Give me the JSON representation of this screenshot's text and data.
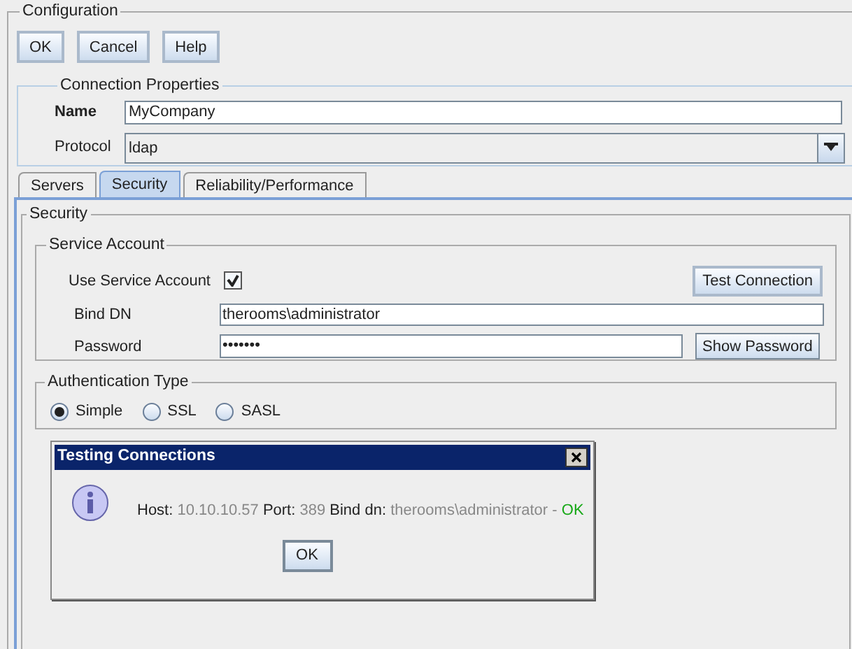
{
  "window": {
    "title": "Configuration"
  },
  "buttons": [
    "OK",
    "Cancel",
    "Help"
  ],
  "connection_properties": {
    "title": "Connection Properties",
    "name": {
      "label": "Name",
      "value": "MyCompany"
    },
    "protocol": {
      "label": "Protocol",
      "value": "ldap"
    }
  },
  "tabs": [
    {
      "label": "Servers",
      "selected": false
    },
    {
      "label": "Security",
      "selected": true
    },
    {
      "label": "Reliability/Performance",
      "selected": false
    }
  ],
  "security": {
    "title": "Security",
    "service_account": {
      "title": "Service Account",
      "use_service_account": {
        "label": "Use Service Account",
        "checked": true
      },
      "test_connection": "Test Connection",
      "bind_dn": {
        "label": "Bind DN",
        "value": "therooms\\administrator"
      },
      "password": {
        "label": "Password",
        "value": "•••••••"
      },
      "show_password": "Show Password"
    },
    "authentication_type": {
      "title": "Authentication Type",
      "options": [
        {
          "label": "Simple",
          "selected": true
        },
        {
          "label": "SSL",
          "selected": false
        },
        {
          "label": "SASL",
          "selected": false
        }
      ]
    }
  },
  "dialog": {
    "title": "Testing Connections",
    "message": [
      {
        "kind": "label",
        "text": "Host:"
      },
      {
        "kind": "value",
        "text": "10.10.10.57"
      },
      {
        "kind": "label",
        "text": "Port:"
      },
      {
        "kind": "value",
        "text": "389"
      },
      {
        "kind": "label",
        "text": "Bind dn:"
      },
      {
        "kind": "value",
        "text": "therooms\\administrator"
      },
      {
        "kind": "value",
        "text": "-"
      },
      {
        "kind": "status",
        "text": "OK"
      }
    ],
    "button": "OK"
  }
}
